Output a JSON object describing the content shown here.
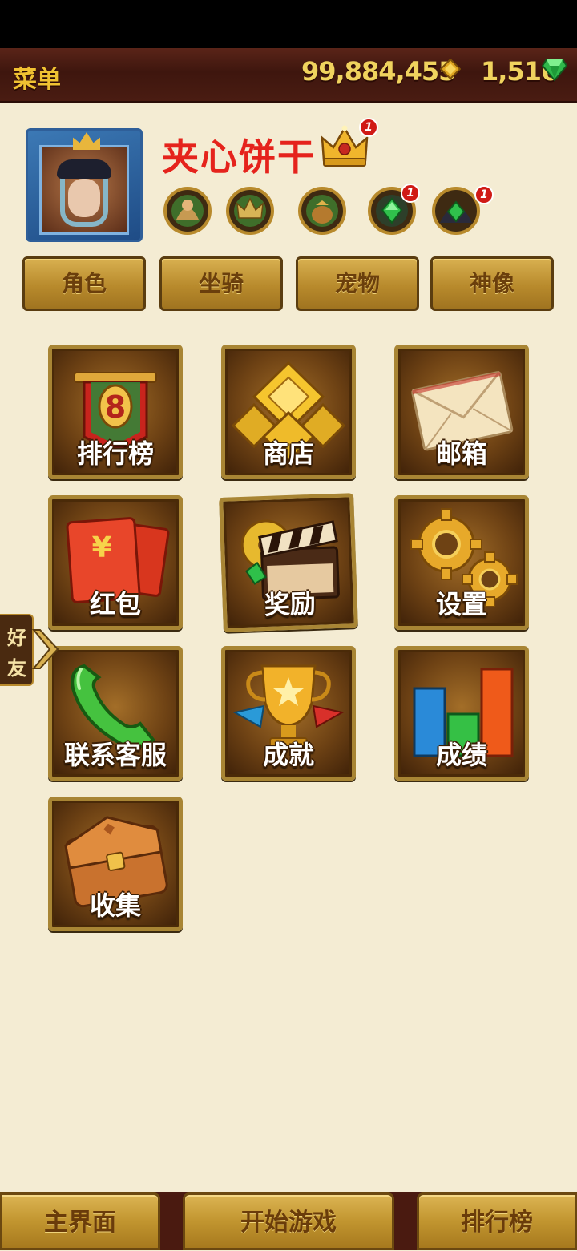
{
  "header": {
    "title": "菜单",
    "gold_amount": "99,884,455",
    "gem_amount": "1,516"
  },
  "profile": {
    "name": "夹心饼干",
    "crown_badge_count": "1",
    "medals": [
      {
        "icon": "warrior-medal-icon",
        "badge": ""
      },
      {
        "icon": "crown-medal-icon",
        "badge": ""
      },
      {
        "icon": "treasure-bag-medal-icon",
        "badge": ""
      },
      {
        "icon": "emerald-crown-medal-icon",
        "badge": "1"
      },
      {
        "icon": "emerald-hood-medal-icon",
        "badge": "1"
      }
    ]
  },
  "tabs": [
    "角色",
    "坐骑",
    "宠物",
    "神像"
  ],
  "menu": [
    {
      "label": "排行榜",
      "icon": "ranking-banner-icon"
    },
    {
      "label": "商店",
      "icon": "gold-pyramid-icon"
    },
    {
      "label": "邮箱",
      "icon": "envelope-icon"
    },
    {
      "label": "红包",
      "icon": "red-envelope-icon"
    },
    {
      "label": "奖励",
      "icon": "film-clapper-icon"
    },
    {
      "label": "设置",
      "icon": "gears-icon"
    },
    {
      "label": "联系客服",
      "icon": "phone-icon"
    },
    {
      "label": "成就",
      "icon": "trophy-icon"
    },
    {
      "label": "成绩",
      "icon": "bar-stats-icon"
    },
    {
      "label": "收集",
      "icon": "leather-pouch-icon"
    }
  ],
  "friends_tab": {
    "char1": "好",
    "char2": "友"
  },
  "bottom_nav": {
    "home": "主界面",
    "start": "开始游戏",
    "ranking": "排行榜"
  },
  "colors": {
    "name_red": "#e5231c",
    "gold_text": "#f0c232",
    "background": "#f4ecd3"
  }
}
